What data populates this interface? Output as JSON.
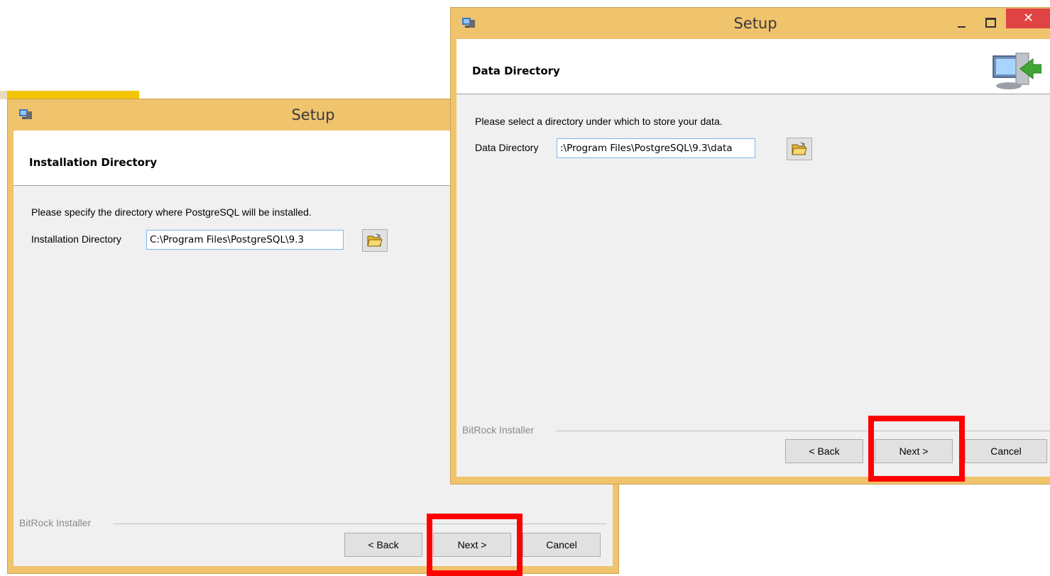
{
  "window_left": {
    "title": "Setup",
    "header_title": "Installation Directory",
    "instruction": "Please specify the directory where PostgreSQL will be installed.",
    "field_label": "Installation Directory",
    "field_value": "C:\\Program Files\\PostgreSQL\\9.3",
    "footer_brand": "BitRock Installer",
    "buttons": {
      "back": "< Back",
      "next": "Next >",
      "cancel": "Cancel"
    }
  },
  "window_right": {
    "title": "Setup",
    "header_title": "Data Directory",
    "instruction": "Please select a directory under which to store your data.",
    "field_label": "Data Directory",
    "field_value": ":\\Program Files\\PostgreSQL\\9.3\\data",
    "footer_brand": "BitRock Installer",
    "buttons": {
      "back": "< Back",
      "next": "Next >",
      "cancel": "Cancel"
    },
    "close_glyph": "✕"
  },
  "icons": [
    "setup-app-icon",
    "folder-open-icon",
    "computer-install-icon",
    "minimize-icon",
    "maximize-icon",
    "close-icon"
  ],
  "colors": {
    "title_bar": "#f0c36d",
    "highlight": "#ff0000",
    "close_button": "#e04343",
    "input_border": "#7eb4ea"
  }
}
